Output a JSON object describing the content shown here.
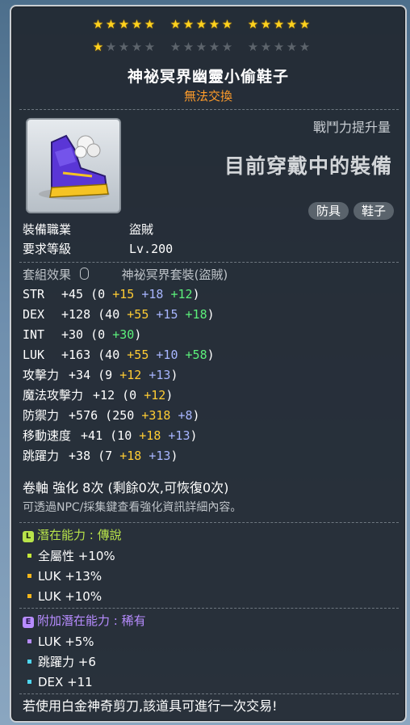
{
  "stars": {
    "row1": {
      "on": 15,
      "off": 0
    },
    "row2": {
      "on": 1,
      "off": 14
    }
  },
  "item": {
    "name": "神祕冥界幽靈小偷鞋子",
    "tradeable": "無法交換",
    "icon": "purple-shoe-icon"
  },
  "power": {
    "label": "戰鬥力提升量",
    "status": "目前穿戴中的裝備"
  },
  "tags": [
    "防具",
    "鞋子"
  ],
  "requirements": [
    {
      "label": "裝備職業",
      "value": "盜賊"
    },
    {
      "label": "要求等級",
      "value": "Lv.200"
    }
  ],
  "set_effect": {
    "label": "套組效果",
    "icon": "mouse-icon",
    "value": "神祕冥界套裝(盜賊)"
  },
  "stats": [
    {
      "name": "STR",
      "total": "+45",
      "base": "0",
      "parts": [
        {
          "v": "+15",
          "c": "yellow"
        },
        {
          "v": "+18",
          "c": "blue"
        },
        {
          "v": "+12",
          "c": "green"
        }
      ]
    },
    {
      "name": "DEX",
      "total": "+128",
      "base": "40",
      "parts": [
        {
          "v": "+55",
          "c": "yellow"
        },
        {
          "v": "+15",
          "c": "blue"
        },
        {
          "v": "+18",
          "c": "green"
        }
      ]
    },
    {
      "name": "INT",
      "total": "+30",
      "base": "0",
      "parts": [
        {
          "v": "+30",
          "c": "green"
        }
      ]
    },
    {
      "name": "LUK",
      "total": "+163",
      "base": "40",
      "parts": [
        {
          "v": "+55",
          "c": "yellow"
        },
        {
          "v": "+10",
          "c": "blue"
        },
        {
          "v": "+58",
          "c": "green"
        }
      ]
    },
    {
      "name": "攻擊力",
      "total": "+34",
      "base": "9",
      "parts": [
        {
          "v": "+12",
          "c": "yellow"
        },
        {
          "v": "+13",
          "c": "blue"
        }
      ]
    },
    {
      "name": "魔法攻擊力",
      "total": "+12",
      "base": "0",
      "parts": [
        {
          "v": "+12",
          "c": "yellow"
        }
      ]
    },
    {
      "name": "防禦力",
      "total": "+576",
      "base": "250",
      "parts": [
        {
          "v": "+318",
          "c": "yellow"
        },
        {
          "v": "+8",
          "c": "blue"
        }
      ]
    },
    {
      "name": "移動速度",
      "total": "+41",
      "base": "10",
      "parts": [
        {
          "v": "+18",
          "c": "yellow"
        },
        {
          "v": "+13",
          "c": "blue"
        }
      ]
    },
    {
      "name": "跳躍力",
      "total": "+38",
      "base": "7",
      "parts": [
        {
          "v": "+18",
          "c": "yellow"
        },
        {
          "v": "+13",
          "c": "blue"
        }
      ]
    }
  ],
  "scroll": {
    "text": "卷軸 強化 8次 (剩餘0次,可恢復0次)",
    "hint": "可透過NPC/採集鍵查看強化資訊詳細內容。"
  },
  "potential": {
    "badge": "L",
    "label": "潛在能力 : 傳說",
    "color": "#b8e34a",
    "lines": [
      "全屬性 +10%",
      "LUK +13%",
      "LUK +10%"
    ],
    "bullet_colors": [
      "#c5e83a",
      "#f2b61c",
      "#f2b61c"
    ]
  },
  "additional": {
    "badge": "E",
    "label": "附加潛在能力 : 稀有",
    "color": "#b78cff",
    "lines": [
      "LUK +5%",
      "跳躍力 +6",
      "DEX +11"
    ],
    "bullet_colors": [
      "#b78cff",
      "#4fd6f0",
      "#4fd6f0"
    ]
  },
  "footer": "若使用白金神奇剪刀,該道具可進行一次交易!"
}
